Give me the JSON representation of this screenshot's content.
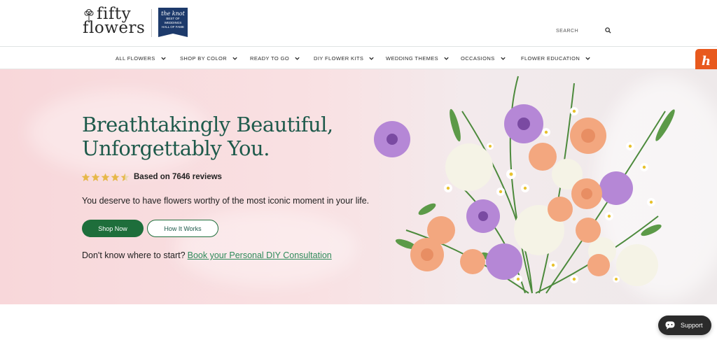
{
  "header": {
    "logo_line1": "fifty",
    "logo_line2": "flowers",
    "badge": {
      "brand": "the knot",
      "line1": "BEST OF",
      "line2": "WEDDINGS",
      "line3": "HALL OF FAME"
    },
    "search": {
      "placeholder": "SEARCH",
      "icon": "search-icon"
    }
  },
  "nav": {
    "items": [
      {
        "label": "ALL FLOWERS"
      },
      {
        "label": "SHOP BY COLOR"
      },
      {
        "label": "READY TO GO"
      },
      {
        "label": "DIY FLOWER KITS"
      },
      {
        "label": "WEDDING THEMES"
      },
      {
        "label": "OCCASIONS"
      },
      {
        "label": "FLOWER EDUCATION"
      }
    ]
  },
  "honey_label": "h",
  "hero": {
    "title_line1": "Breathtakingly Beautiful,",
    "title_line2": "Unforgettably You.",
    "rating": 4.5,
    "reviews": "Based on 7646 reviews",
    "subtext": "You deserve to have flowers worthy of the most iconic moment in your life.",
    "primary_cta": "Shop Now",
    "secondary_cta": "How It Works",
    "consult_prompt": "Don't know where to start?",
    "consult_link": "Book your Personal DIY Consultation"
  },
  "support_label": "Support",
  "colors": {
    "brand_green": "#1e6e3b",
    "title_green": "#1e5a4b",
    "star": "#e6b84a",
    "hero_pink": "#f8d7da",
    "honey_orange": "#e8591d"
  }
}
